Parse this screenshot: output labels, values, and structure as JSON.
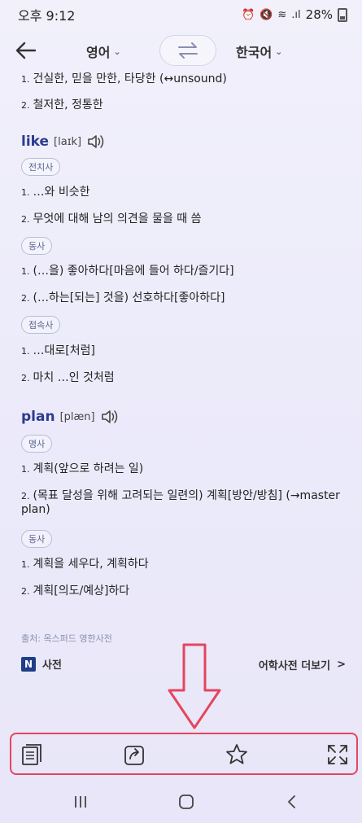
{
  "status": {
    "time": "오후 9:12",
    "battery": "28%"
  },
  "header": {
    "source_lang": "영어",
    "target_lang": "한국어"
  },
  "entries": {
    "top_lines": [
      {
        "num": "1.",
        "text": "건실한, 믿을 만한, 타당한 (↔unsound)"
      },
      {
        "num": "2.",
        "text": "철저한, 정통한"
      }
    ],
    "like": {
      "word": "like",
      "phonetic": "[laɪk]",
      "sections": [
        {
          "pos": "전치사",
          "senses": [
            {
              "num": "1.",
              "text": "…와 비슷한"
            },
            {
              "num": "2.",
              "text": "무엇에 대해 남의 의견을 물을 때 씀"
            }
          ]
        },
        {
          "pos": "동사",
          "senses": [
            {
              "num": "1.",
              "text": "(…을) 좋아하다[마음에 들어 하다/즐기다]"
            },
            {
              "num": "2.",
              "text": "(…하는[되는] 것을) 선호하다[좋아하다]"
            }
          ]
        },
        {
          "pos": "접속사",
          "senses": [
            {
              "num": "1.",
              "text": "…대로[처럼]"
            },
            {
              "num": "2.",
              "text": "마치 …인 것처럼"
            }
          ]
        }
      ]
    },
    "plan": {
      "word": "plan",
      "phonetic": "[plæn]",
      "sections": [
        {
          "pos": "명사",
          "senses": [
            {
              "num": "1.",
              "text": "계획(앞으로 하려는 일)"
            },
            {
              "num": "2.",
              "text": "(목표 달성을 위해 고려되는 일련의) 계획[방안/방침] (→master",
              "cont": "plan)"
            }
          ]
        },
        {
          "pos": "동사",
          "senses": [
            {
              "num": "1.",
              "text": "계획을 세우다, 계획하다"
            },
            {
              "num": "2.",
              "text": "계획[의도/예상]하다"
            }
          ]
        }
      ]
    }
  },
  "footer": {
    "source": "출처: 옥스퍼드 영한사전",
    "naver_badge": "N",
    "naver_label": "사전",
    "more_label": "어학사전 더보기",
    "more_chevron": ">"
  },
  "icons": {
    "back": "arrow-left-icon",
    "swap": "swap-icon",
    "speaker": "speaker-icon",
    "toolbar": [
      "notes-icon",
      "share-icon",
      "star-icon",
      "expand-icon"
    ],
    "nav": [
      "recents-icon",
      "home-icon",
      "back-nav-icon"
    ]
  },
  "colors": {
    "highlight": "#e5455f",
    "headword": "#2b3b8f",
    "chip_border": "#b9bcd8"
  }
}
